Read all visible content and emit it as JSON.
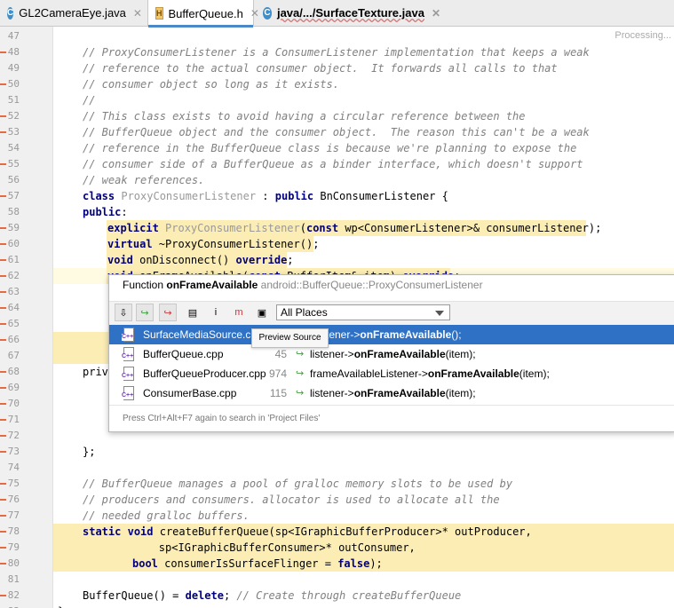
{
  "tabs": [
    {
      "label": "GL2CameraEye.java",
      "icon": "C"
    },
    {
      "label": "BufferQueue.h",
      "icon": "H"
    },
    {
      "label": "java/.../SurfaceTexture.java",
      "icon": "C"
    }
  ],
  "status": "Processing...",
  "code_lines": [
    {
      "n": "47",
      "text": ""
    },
    {
      "n": "48",
      "text": "// ProxyConsumerListener is a ConsumerListener implementation that keeps a weak"
    },
    {
      "n": "49",
      "text": "// reference to the actual consumer object.  It forwards all calls to that"
    },
    {
      "n": "50",
      "text": "// consumer object so long as it exists."
    },
    {
      "n": "51",
      "text": "//"
    },
    {
      "n": "52",
      "text": "// This class exists to avoid having a circular reference between the"
    },
    {
      "n": "53",
      "text": "// BufferQueue object and the consumer object.  The reason this can't be a weak"
    },
    {
      "n": "54",
      "text": "// reference in the BufferQueue class is because we're planning to expose the"
    },
    {
      "n": "55",
      "text": "// consumer side of a BufferQueue as a binder interface, which doesn't support"
    },
    {
      "n": "56",
      "text": "// weak references."
    },
    {
      "n": "57",
      "k1": "class",
      "dimtxt": "ProxyConsumerListener",
      "mid": " : ",
      "k2": "public",
      "rest": " BnConsumerListener {"
    },
    {
      "n": "58",
      "k1": "public",
      "rest": ":"
    },
    {
      "n": "59",
      "k1": "explicit",
      "dimtxt": "ProxyConsumerListener",
      "mid": "(",
      "k2": "const",
      "rest": " wp<ConsumerListener>& consumerListener);"
    },
    {
      "n": "60",
      "k1": "virtual",
      "rest": " ~ProxyConsumerListener();"
    },
    {
      "n": "61",
      "k1": "void",
      "rest": " onDisconnect() ",
      "k2": "override",
      "tail": ";"
    },
    {
      "n": "62",
      "k1": "void",
      "rest": " onFrameAvailable(",
      "k2": "const",
      "tail": " BufferItem& item) ",
      "k3": "override",
      "tail2": ";"
    },
    {
      "n": "63",
      "text": ""
    },
    {
      "n": "64",
      "text": ""
    },
    {
      "n": "65",
      "text": ""
    },
    {
      "n": "66",
      "text": ""
    },
    {
      "n": "67",
      "text": ""
    },
    {
      "n": "68",
      "text": "priv"
    },
    {
      "n": "69",
      "text": ""
    },
    {
      "n": "70",
      "text": ""
    },
    {
      "n": "71",
      "text": ""
    },
    {
      "n": "72",
      "text": ""
    },
    {
      "n": "73",
      "text": "};"
    },
    {
      "n": "74",
      "text": ""
    },
    {
      "n": "75",
      "text": "// BufferQueue manages a pool of gralloc memory slots to be used by"
    },
    {
      "n": "76",
      "text": "// producers and consumers. allocator is used to allocate all the"
    },
    {
      "n": "77",
      "text": "// needed gralloc buffers."
    },
    {
      "n": "78",
      "k1": "static",
      "k2": "void",
      "rest": " createBufferQueue(sp<IGraphicBufferProducer>* outProducer,"
    },
    {
      "n": "79",
      "text": "        sp<IGraphicBufferConsumer>* outConsumer,"
    },
    {
      "n": "80",
      "k1": "bool",
      "rest": " consumerIsSurfaceFlinger = ",
      "k2": "false",
      "tail": ");"
    },
    {
      "n": "81",
      "text": ""
    },
    {
      "n": "82",
      "text": "BufferQueue() = ",
      "k1": "delete",
      "tail": "; ",
      "comment": "// Create through createBufferQueue"
    },
    {
      "n": "83",
      "text": "};"
    }
  ],
  "popup": {
    "kind": "Function",
    "name": "onFrameAvailable",
    "scope": "android::BufferQueue::ProxyConsumerListener",
    "scope_select": "All Places",
    "results": [
      {
        "file": "SurfaceMediaSource.cpp",
        "line": "",
        "snippet_pre": "tener->",
        "snippet_bold": "onFrameAvailable",
        "snippet_post": "();"
      },
      {
        "file": "BufferQueue.cpp",
        "line": "45",
        "snippet_pre": "listener->",
        "snippet_bold": "onFrameAvailable",
        "snippet_post": "(item);"
      },
      {
        "file": "BufferQueueProducer.cpp",
        "line": "974",
        "snippet_pre": "frameAvailableListener->",
        "snippet_bold": "onFrameAvailable",
        "snippet_post": "(item);"
      },
      {
        "file": "ConsumerBase.cpp",
        "line": "115",
        "snippet_pre": "listener->",
        "snippet_bold": "onFrameAvailable",
        "snippet_post": "(item);"
      }
    ],
    "footer": "Press Ctrl+Alt+F7 again to search in 'Project Files'",
    "tooltip": "Preview Source"
  }
}
